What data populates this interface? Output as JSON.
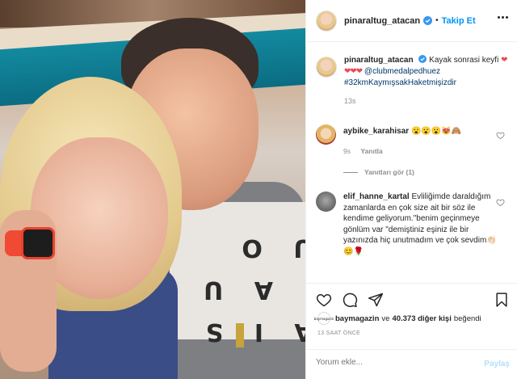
{
  "post": {
    "author": "pinaraltug_atacan",
    "follow_label": "Takip Et",
    "separator": "•",
    "caption_text": "Kayak sonrasi keyfi",
    "caption_hearts": "❤❤❤❤",
    "caption_mention": "@clubmedalpedhuez",
    "caption_hashtag": "#32kmKaymışsakHaketmişizdir",
    "caption_time": "13s"
  },
  "comments": [
    {
      "user": "aybike_karahisar",
      "text": "😮😮😮😻🙈",
      "time": "9s",
      "reply_label": "Yanıtla",
      "view_replies": "Yanıtları gör (1)"
    },
    {
      "user": "elif_hanne_kartal",
      "text": "Evliliğimde daraldığım zamanlarda en çok size ait bir söz ile kendime geliyorum.\"benim geçinmeye gönlüm var \"demiştiniz eşiniz ile bir yazınızda hiç unutmadım ve çok sevdim👏🏻😊🌹"
    }
  ],
  "likes": {
    "liker_avatar_text": "baymagazin",
    "liker": "baymagazin",
    "connector": "ve",
    "others": "40.373 diğer kişi",
    "suffix": "beğendi"
  },
  "timestamp": "13 SAAT ÖNCE",
  "comment_input": {
    "placeholder": "Yorum ekle...",
    "post_label": "Paylaş"
  },
  "photo": {
    "shirt_letters": "A I S\nI A U\nU O"
  },
  "icons": {
    "verified": "verified-badge-icon",
    "more": "more-options-icon",
    "like": "heart-icon",
    "comment": "comment-icon",
    "share": "share-icon",
    "save": "bookmark-icon"
  },
  "colors": {
    "accent": "#0095f6",
    "link": "#00376b",
    "muted": "#8e8e8e",
    "border": "#efefef"
  }
}
